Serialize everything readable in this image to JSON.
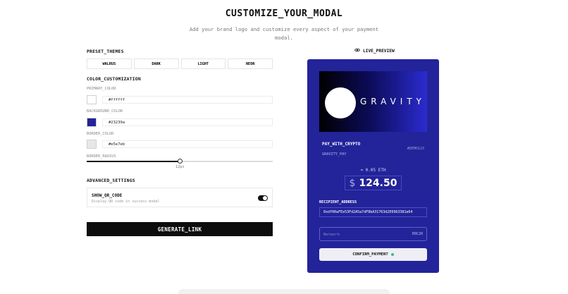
{
  "header": {
    "title": "CUSTOMIZE_YOUR_MODAL",
    "subtitle": "Add your brand logo and customize every aspect of your payment modal."
  },
  "preset_themes": {
    "heading": "PRESET_THEMES",
    "options": [
      "WALRUS",
      "DARK",
      "LIGHT",
      "NEON"
    ]
  },
  "color_customization": {
    "heading": "COLOR_CUSTOMIZATION",
    "primary": {
      "label": "PRIMARY_COLOR",
      "value": "#ffffff",
      "color": "#ffffff"
    },
    "background": {
      "label": "BACKGROUND_COLOR",
      "value": "#23239a",
      "color": "#23239a"
    },
    "border": {
      "label": "BORDER_COLOR",
      "value": "#e5e7eb",
      "color": "#e5e7eb"
    }
  },
  "border_radius": {
    "label": "BORDER_RADIUS",
    "value_text": "12px",
    "value": 12,
    "fraction": 0.5
  },
  "advanced_settings": {
    "heading": "ADVANCED_SETTINGS",
    "qr_title": "SHOW_QR_CODE",
    "qr_desc": "Display QR code in success modal",
    "qr_enabled": true
  },
  "generate_label": "GENERATE_LINK",
  "live_preview": {
    "heading": "LIVE_PREVIEW",
    "icon": "eye-icon",
    "modal_bg": "#23239a",
    "logo_text": "GRAVITY",
    "pay_title": "PAY_WITH_CRYPTO",
    "pay_id": "#DEMO123",
    "merchant": "GRAVITY_PAY",
    "eth_amount": "≈ 0.05  ETH",
    "currency_symbol": "$",
    "amount": "124.50",
    "recipient_label": "RECIPIENT_ADDRESS",
    "recipient_address": "0xdf00aFEe53Fd2A5a7dF8bA31763d2E6963381e64",
    "network_placeholder": "Network",
    "network_tag": "ERC20",
    "confirm_label": "CONFIRM_PAYMENT"
  }
}
